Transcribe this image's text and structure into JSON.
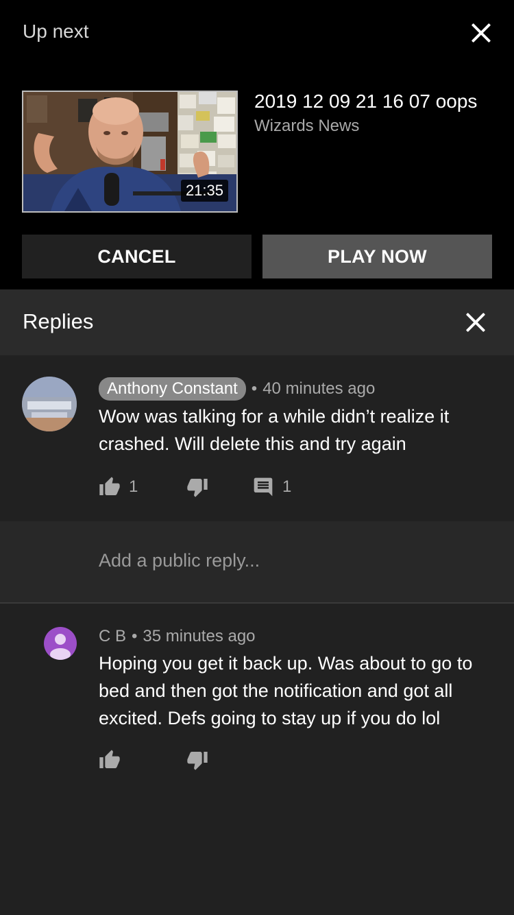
{
  "up_next": {
    "label": "Up next",
    "video": {
      "title": "2019 12 09 21 16 07 oops",
      "channel": "Wizards News",
      "duration": "21:35"
    },
    "cancel_label": "CANCEL",
    "play_now_label": "PLAY NOW"
  },
  "replies": {
    "title": "Replies",
    "parent_comment": {
      "author": "Anthony Constant",
      "time": "40 minutes ago",
      "text": "Wow was talking for a while didn’t realize it crashed. Will delete this and try again",
      "likes": "1",
      "replies": "1"
    },
    "add_reply_placeholder": "Add a public reply...",
    "reply": {
      "author": "C B",
      "time": "35 minutes ago",
      "text": "Hoping you get it back up. Was about to go to bed and then got the notification and got all excited. Defs going to stay up if you do lol",
      "avatar_color": "#9c4fc8"
    }
  },
  "icons": {
    "close": "close-icon",
    "like": "thumb-up-icon",
    "dislike": "thumb-down-icon",
    "reply": "comment-icon"
  },
  "colors": {
    "background": "#212121",
    "header_background": "#2b2b2b",
    "up_next_background": "#000000",
    "play_button": "#555555"
  }
}
